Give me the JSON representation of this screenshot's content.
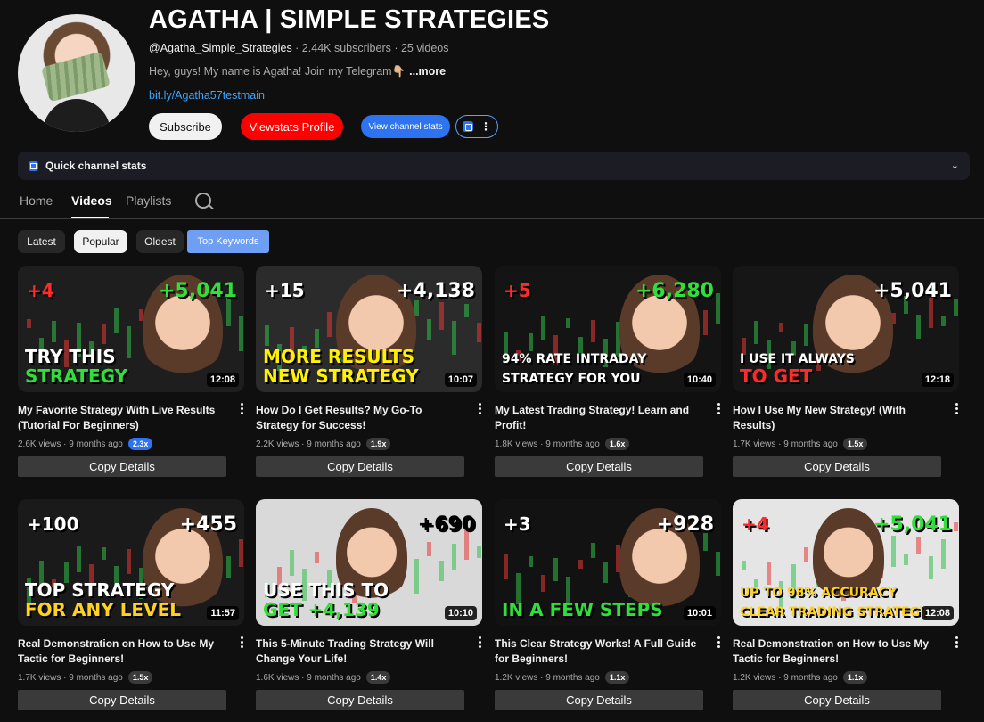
{
  "channel": {
    "title": "AGATHA | SIMPLE STRATEGIES",
    "handle": "@Agatha_Simple_Strategies",
    "stats": " · 2.44K subscribers · 25 videos",
    "description": "Hey, guys! My name is Agatha! Join my Telegram👇🏼",
    "more": "...more",
    "link": "bit.ly/Agatha57testmain"
  },
  "buttons": {
    "subscribe": "Subscribe",
    "viewstats_profile": "Viewstats Profile",
    "view_channel_stats": "View channel stats",
    "ext_more": "⋮"
  },
  "quick_stats": {
    "label": "Quick channel stats",
    "chevron": "⌄"
  },
  "tabs": [
    {
      "label": "Home"
    },
    {
      "label": "Videos"
    },
    {
      "label": "Playlists"
    }
  ],
  "chips": [
    "Latest",
    "Popular",
    "Oldest",
    "Top Keywords"
  ],
  "videos": [
    {
      "title": "My Favorite Strategy With Live Results (Tutorial For Beginners)",
      "views": "2.6K views · 9 months ago",
      "badge": "2.3x",
      "duration": "12:08",
      "copy": "Copy Details",
      "thumb": {
        "bg": "#1e1e1e",
        "l1": "TRY THIS",
        "l2": "STRATEGY",
        "n1": "+4",
        "n2": "+5,041"
      }
    },
    {
      "title": "How Do I Get Results? My Go-To Strategy for Success!",
      "views": "2.2K views · 9 months ago",
      "badge": "1.9x",
      "duration": "10:07",
      "copy": "Copy Details",
      "thumb": {
        "bg": "#2b2b2b",
        "l1": "MORE RESULTS",
        "l2": "NEW STRATEGY",
        "n1": "+15",
        "n2": "+4,138"
      }
    },
    {
      "title": "My Latest Trading Strategy! Learn and Profit!",
      "views": "1.8K views · 9 months ago",
      "badge": "1.6x",
      "duration": "10:40",
      "copy": "Copy Details",
      "thumb": {
        "bg": "#141414",
        "l1": "94% RATE INTRADAY",
        "l2": "STRATEGY FOR YOU",
        "n1": "+5",
        "n2": "+6,280"
      }
    },
    {
      "title": "How I Use My New Strategy! (With Results)",
      "views": "1.7K views · 9 months ago",
      "badge": "1.5x",
      "duration": "12:18",
      "copy": "Copy Details",
      "thumb": {
        "bg": "#161616",
        "l1": "I USE IT ALWAYS",
        "l2": "TO GET",
        "n1": "",
        "n2": "+5,041"
      }
    },
    {
      "title": "Real Demonstration on How to Use My Tactic for Beginners!",
      "views": "1.7K views · 9 months ago",
      "badge": "1.5x",
      "duration": "11:57",
      "copy": "Copy Details",
      "thumb": {
        "bg": "#1a1a1a",
        "l1": "TOP STRATEGY",
        "l2": "FOR ANY LEVEL",
        "n1": "+100",
        "n2": "+455"
      }
    },
    {
      "title": "This 5-Minute Trading Strategy Will Change Your Life!",
      "views": "1.6K views · 9 months ago",
      "badge": "1.4x",
      "duration": "10:10",
      "copy": "Copy Details",
      "thumb": {
        "bg": "#d9d9d9",
        "l1": "USE THIS TO",
        "l2": "GET +4,139",
        "n1": "",
        "n2": "+690"
      }
    },
    {
      "title": "This Clear Strategy Works! A Full Guide for Beginners!",
      "views": "1.2K views · 9 months ago",
      "badge": "1.1x",
      "duration": "10:01",
      "copy": "Copy Details",
      "thumb": {
        "bg": "#121212",
        "l1": "",
        "l2": "IN A FEW STEPS",
        "n1": "+3",
        "n2": "+928"
      }
    },
    {
      "title": "Real Demonstration on How to Use My Tactic for Beginners!",
      "views": "1.2K views · 9 months ago",
      "badge": "1.1x",
      "duration": "12:08",
      "copy": "Copy Details",
      "thumb": {
        "bg": "#e5e5e5",
        "l1": "UP TO 98% ACCURACY",
        "l2": "CLEAR TRADING STRATEGY",
        "n1": "+4",
        "n2": "+5,041"
      }
    }
  ]
}
